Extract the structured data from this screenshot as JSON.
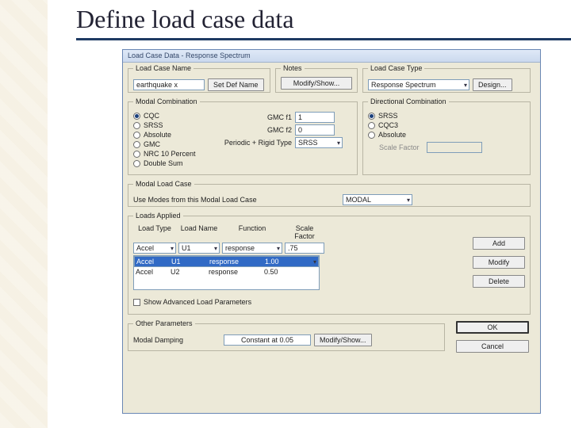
{
  "slide_title": "Define load case data",
  "dialog": {
    "title": "Load Case Data - Response Spectrum"
  },
  "lcn": {
    "legend": "Load Case Name",
    "value": "earthquake x",
    "set_btn": "Set Def Name"
  },
  "notes": {
    "legend": "Notes",
    "modify_btn": "Modify/Show..."
  },
  "lct": {
    "legend": "Load Case Type",
    "value": "Response Spectrum",
    "design_btn": "Design..."
  },
  "modal": {
    "legend": "Modal Combination",
    "options": [
      "CQC",
      "SRSS",
      "Absolute",
      "GMC",
      "NRC 10 Percent",
      "Double Sum"
    ],
    "gmc_f1_lbl": "GMC f1",
    "gmc_f1": "1",
    "gmc_f2_lbl": "GMC f2",
    "gmc_f2": "0",
    "prt_lbl": "Periodic + Rigid Type",
    "prt": "SRSS"
  },
  "dir": {
    "legend": "Directional Combination",
    "options": [
      "SRSS",
      "CQC3",
      "Absolute"
    ],
    "scale_lbl": "Scale Factor"
  },
  "mlc": {
    "legend": "Modal Load Case",
    "lbl": "Use Modes from this Modal Load Case",
    "value": "MODAL"
  },
  "loads": {
    "legend": "Loads Applied",
    "headers": [
      "Load Type",
      "Load Name",
      "Function",
      "Scale Factor"
    ],
    "edit": {
      "type": "Accel",
      "name": "U1",
      "func": "response",
      "sf": ".75"
    },
    "rows": [
      {
        "type": "Accel",
        "name": "U1",
        "func": "response",
        "sf": "1.00",
        "selected": true
      },
      {
        "type": "Accel",
        "name": "U2",
        "func": "response",
        "sf": "0.50"
      }
    ],
    "btns": {
      "add": "Add",
      "modify": "Modify",
      "delete": "Delete"
    },
    "adv": "Show Advanced Load Parameters"
  },
  "other": {
    "legend": "Other Parameters",
    "damping_lbl": "Modal Damping",
    "damping_val": "Constant at 0.05",
    "ms_btn": "Modify/Show..."
  },
  "footer": {
    "ok": "OK",
    "cancel": "Cancel"
  }
}
